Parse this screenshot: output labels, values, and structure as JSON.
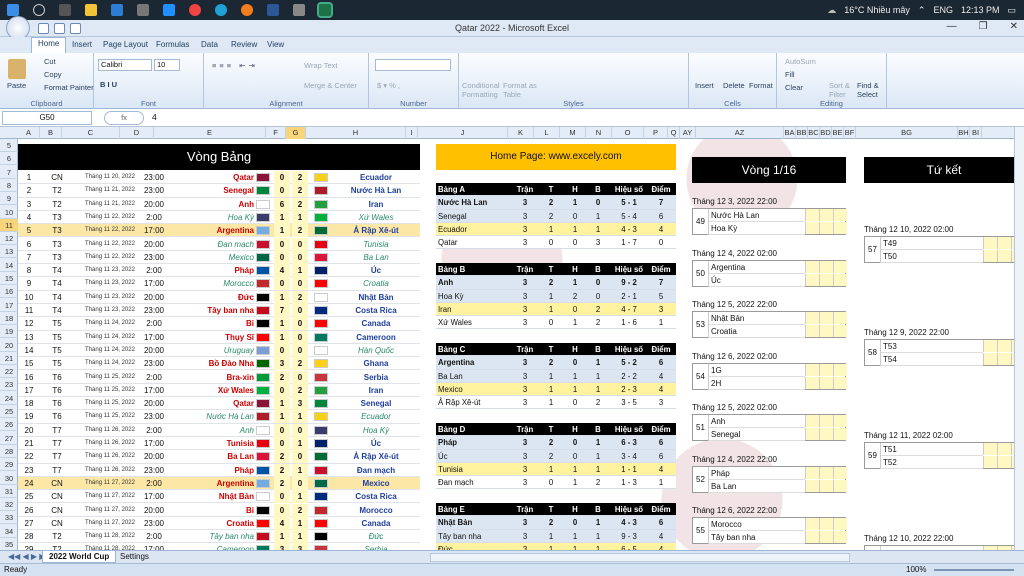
{
  "taskbar": {
    "weather": "16°C  Nhiều mây",
    "lang": "ENG",
    "time": "12:13 PM"
  },
  "window": {
    "title": "Qatar 2022 - Microsoft Excel"
  },
  "ribbon_tabs": [
    "Home",
    "Insert",
    "Page Layout",
    "Formulas",
    "Data",
    "Review",
    "View"
  ],
  "ribbon": {
    "paste": "Paste",
    "cut": "Cut",
    "copy": "Copy",
    "format_painter": "Format Painter",
    "clipboard": "Clipboard",
    "font_name": "Calibri",
    "font_size": "10",
    "font": "Font",
    "wrap": "Wrap Text",
    "merge": "Merge & Center",
    "alignment": "Alignment",
    "number": "Number",
    "cond_fmt": "Conditional Formatting",
    "fmt_table": "Format as Table",
    "styles": "Styles",
    "insert": "Insert",
    "delete": "Delete",
    "format": "Format",
    "cells": "Cells",
    "autosum": "AutoSum",
    "fill": "Fill",
    "clear": "Clear",
    "sort": "Sort & Filter",
    "find": "Find & Select",
    "editing": "Editing"
  },
  "formula_bar": {
    "name_box": "G50",
    "fx": "fx",
    "value": "4"
  },
  "columns": [
    "A",
    "B",
    "C",
    "D",
    "E",
    "F",
    "G",
    "H",
    "I",
    "J",
    "K",
    "L",
    "M",
    "N",
    "O",
    "P",
    "Q",
    "AY",
    "AZ",
    "BA",
    "BB",
    "BC",
    "BD",
    "BE",
    "BF",
    "BG",
    "BH",
    "BI"
  ],
  "rows": [
    "5",
    "6",
    "7",
    "8",
    "9",
    "10",
    "11",
    "12",
    "13",
    "14",
    "15",
    "16",
    "17",
    "18",
    "19",
    "20",
    "21",
    "22",
    "23",
    "24",
    "25",
    "26",
    "27",
    "28",
    "29",
    "30",
    "31",
    "32",
    "33",
    "34",
    "35"
  ],
  "group_stage_title": "Vòng Bảng",
  "matches": [
    {
      "no": "1",
      "grp": "CN",
      "date": "Tháng 11 20, 2022",
      "time": "23:00",
      "home": "Qatar",
      "s1": "0",
      "s2": "2",
      "away": "Ecuador",
      "fa": "#8a1538",
      "fb": "#f7d116"
    },
    {
      "no": "2",
      "grp": "T2",
      "date": "Tháng 11 21, 2022",
      "time": "23:00",
      "home": "Senegal",
      "s1": "0",
      "s2": "2",
      "away": "Nước Hà Lan",
      "fa": "#00853f",
      "fb": "#ae1c28"
    },
    {
      "no": "3",
      "grp": "T2",
      "date": "Tháng 11 21, 2022",
      "time": "20:00",
      "home": "Anh",
      "s1": "6",
      "s2": "2",
      "away": "Iran",
      "fa": "#ffffff",
      "fb": "#239f40"
    },
    {
      "no": "4",
      "grp": "T3",
      "date": "Tháng 11 22, 2022",
      "time": "2:00",
      "home": "Hoa Kỳ",
      "s1": "1",
      "s2": "1",
      "away": "Xứ Wales",
      "fa": "#3c3b6e",
      "fb": "#00b140",
      "it": true
    },
    {
      "no": "5",
      "grp": "T3",
      "date": "Tháng 11 22, 2022",
      "time": "17:00",
      "home": "Argentina",
      "s1": "1",
      "s2": "2",
      "away": "Ả Rập Xê-út",
      "fa": "#74acdf",
      "fb": "#006c35"
    },
    {
      "no": "6",
      "grp": "T3",
      "date": "Tháng 11 22, 2022",
      "time": "20:00",
      "home": "Đan mạch",
      "s1": "0",
      "s2": "0",
      "away": "Tunisia",
      "fa": "#c8102e",
      "fb": "#e70013",
      "it": true
    },
    {
      "no": "7",
      "grp": "T3",
      "date": "Tháng 11 22, 2022",
      "time": "23:00",
      "home": "Mexico",
      "s1": "0",
      "s2": "0",
      "away": "Ba Lan",
      "fa": "#006847",
      "fb": "#dc143c",
      "it": true
    },
    {
      "no": "8",
      "grp": "T4",
      "date": "Tháng 11 23, 2022",
      "time": "2:00",
      "home": "Pháp",
      "s1": "4",
      "s2": "1",
      "away": "Úc",
      "fa": "#0055a4",
      "fb": "#012169"
    },
    {
      "no": "9",
      "grp": "T4",
      "date": "Tháng 11 23, 2022",
      "time": "17:00",
      "home": "Morocco",
      "s1": "0",
      "s2": "0",
      "away": "Croatia",
      "fa": "#c1272d",
      "fb": "#ff0000",
      "it": true
    },
    {
      "no": "10",
      "grp": "T4",
      "date": "Tháng 11 23, 2022",
      "time": "20:00",
      "home": "Đức",
      "s1": "1",
      "s2": "2",
      "away": "Nhật Bản",
      "fa": "#000000",
      "fb": "#ffffff"
    },
    {
      "no": "11",
      "grp": "T4",
      "date": "Tháng 11 23, 2022",
      "time": "23:00",
      "home": "Tây ban nha",
      "s1": "7",
      "s2": "0",
      "away": "Costa Rica",
      "fa": "#c60b1e",
      "fb": "#002b7f"
    },
    {
      "no": "12",
      "grp": "T5",
      "date": "Tháng 11 24, 2022",
      "time": "2:00",
      "home": "Bỉ",
      "s1": "1",
      "s2": "0",
      "away": "Canada",
      "fa": "#000000",
      "fb": "#ff0000"
    },
    {
      "no": "13",
      "grp": "T5",
      "date": "Tháng 11 24, 2022",
      "time": "17:00",
      "home": "Thụy Sĩ",
      "s1": "1",
      "s2": "0",
      "away": "Cameroon",
      "fa": "#ff0000",
      "fb": "#007a5e"
    },
    {
      "no": "14",
      "grp": "T5",
      "date": "Tháng 11 24, 2022",
      "time": "20:00",
      "home": "Uruguay",
      "s1": "0",
      "s2": "0",
      "away": "Hàn Quốc",
      "fa": "#7b9fd4",
      "fb": "#ffffff",
      "it": true
    },
    {
      "no": "15",
      "grp": "T5",
      "date": "Tháng 11 24, 2022",
      "time": "23:00",
      "home": "Bồ Đào Nha",
      "s1": "3",
      "s2": "2",
      "away": "Ghana",
      "fa": "#006600",
      "fb": "#fcd116"
    },
    {
      "no": "16",
      "grp": "T6",
      "date": "Tháng 11 25, 2022",
      "time": "2:00",
      "home": "Bra-xin",
      "s1": "2",
      "s2": "0",
      "away": "Serbia",
      "fa": "#009c3b",
      "fb": "#c6363c"
    },
    {
      "no": "17",
      "grp": "T6",
      "date": "Tháng 11 25, 2022",
      "time": "17:00",
      "home": "Xứ Wales",
      "s1": "0",
      "s2": "2",
      "away": "Iran",
      "fa": "#00b140",
      "fb": "#239f40"
    },
    {
      "no": "18",
      "grp": "T6",
      "date": "Tháng 11 25, 2022",
      "time": "20:00",
      "home": "Qatar",
      "s1": "1",
      "s2": "3",
      "away": "Senegal",
      "fa": "#8a1538",
      "fb": "#00853f"
    },
    {
      "no": "19",
      "grp": "T6",
      "date": "Tháng 11 25, 2022",
      "time": "23:00",
      "home": "Nước Hà Lan",
      "s1": "1",
      "s2": "1",
      "away": "Ecuador",
      "fa": "#ae1c28",
      "fb": "#f7d116",
      "it": true
    },
    {
      "no": "20",
      "grp": "T7",
      "date": "Tháng 11 26, 2022",
      "time": "2:00",
      "home": "Anh",
      "s1": "0",
      "s2": "0",
      "away": "Hoa Kỳ",
      "fa": "#ffffff",
      "fb": "#3c3b6e",
      "it": true
    },
    {
      "no": "21",
      "grp": "T7",
      "date": "Tháng 11 26, 2022",
      "time": "17:00",
      "home": "Tunisia",
      "s1": "0",
      "s2": "1",
      "away": "Úc",
      "fa": "#e70013",
      "fb": "#012169"
    },
    {
      "no": "22",
      "grp": "T7",
      "date": "Tháng 11 26, 2022",
      "time": "20:00",
      "home": "Ba Lan",
      "s1": "2",
      "s2": "0",
      "away": "Ả Rập Xê-út",
      "fa": "#dc143c",
      "fb": "#006c35"
    },
    {
      "no": "23",
      "grp": "T7",
      "date": "Tháng 11 26, 2022",
      "time": "23:00",
      "home": "Pháp",
      "s1": "2",
      "s2": "1",
      "away": "Đan mạch",
      "fa": "#0055a4",
      "fb": "#c8102e"
    },
    {
      "no": "24",
      "grp": "CN",
      "date": "Tháng 11 27, 2022",
      "time": "2:00",
      "home": "Argentina",
      "s1": "2",
      "s2": "0",
      "away": "Mexico",
      "fa": "#74acdf",
      "fb": "#006847"
    },
    {
      "no": "25",
      "grp": "CN",
      "date": "Tháng 11 27, 2022",
      "time": "17:00",
      "home": "Nhật Bản",
      "s1": "0",
      "s2": "1",
      "away": "Costa Rica",
      "fa": "#ffffff",
      "fb": "#002b7f"
    },
    {
      "no": "26",
      "grp": "CN",
      "date": "Tháng 11 27, 2022",
      "time": "20:00",
      "home": "Bỉ",
      "s1": "0",
      "s2": "2",
      "away": "Morocco",
      "fa": "#000000",
      "fb": "#c1272d"
    },
    {
      "no": "27",
      "grp": "CN",
      "date": "Tháng 11 27, 2022",
      "time": "23:00",
      "home": "Croatia",
      "s1": "4",
      "s2": "1",
      "away": "Canada",
      "fa": "#ff0000",
      "fb": "#ff0000"
    },
    {
      "no": "28",
      "grp": "T2",
      "date": "Tháng 11 28, 2022",
      "time": "2:00",
      "home": "Tây ban nha",
      "s1": "1",
      "s2": "1",
      "away": "Đức",
      "fa": "#c60b1e",
      "fb": "#000000",
      "it": true
    },
    {
      "no": "29",
      "grp": "T2",
      "date": "Tháng 11 28, 2022",
      "time": "17:00",
      "home": "Cameroon",
      "s1": "3",
      "s2": "3",
      "away": "Serbia",
      "fa": "#007a5e",
      "fb": "#c6363c",
      "it": true
    }
  ],
  "home_page": "Home Page: www.excely.com",
  "group_headers": [
    "Trận",
    "T",
    "H",
    "B",
    "Hiệu số",
    "Điểm"
  ],
  "groups": [
    {
      "name": "Bảng A",
      "rows": [
        [
          "Nước Hà Lan",
          "3",
          "2",
          "1",
          "0",
          "5 - 1",
          "7"
        ],
        [
          "Senegal",
          "3",
          "2",
          "0",
          "1",
          "5 - 4",
          "6"
        ],
        [
          "Ecuador",
          "3",
          "1",
          "1",
          "1",
          "4 - 3",
          "4"
        ],
        [
          "Qatar",
          "3",
          "0",
          "0",
          "3",
          "1 - 7",
          "0"
        ]
      ]
    },
    {
      "name": "Bảng B",
      "rows": [
        [
          "Anh",
          "3",
          "2",
          "1",
          "0",
          "9 - 2",
          "7"
        ],
        [
          "Hoa Kỳ",
          "3",
          "1",
          "2",
          "0",
          "2 - 1",
          "5"
        ],
        [
          "Iran",
          "3",
          "1",
          "0",
          "2",
          "4 - 7",
          "3"
        ],
        [
          "Xứ Wales",
          "3",
          "0",
          "1",
          "2",
          "1 - 6",
          "1"
        ]
      ]
    },
    {
      "name": "Bảng C",
      "rows": [
        [
          "Argentina",
          "3",
          "2",
          "0",
          "1",
          "5 - 2",
          "6"
        ],
        [
          "Ba Lan",
          "3",
          "1",
          "1",
          "1",
          "2 - 2",
          "4"
        ],
        [
          "Mexico",
          "3",
          "1",
          "1",
          "1",
          "2 - 3",
          "4"
        ],
        [
          "Ả Rập Xê-út",
          "3",
          "1",
          "0",
          "2",
          "3 - 5",
          "3"
        ]
      ]
    },
    {
      "name": "Bảng D",
      "rows": [
        [
          "Pháp",
          "3",
          "2",
          "0",
          "1",
          "6 - 3",
          "6"
        ],
        [
          "Úc",
          "3",
          "2",
          "0",
          "1",
          "3 - 4",
          "6"
        ],
        [
          "Tunisia",
          "3",
          "1",
          "1",
          "1",
          "1 - 1",
          "4"
        ],
        [
          "Đan mạch",
          "3",
          "0",
          "1",
          "2",
          "1 - 3",
          "1"
        ]
      ]
    },
    {
      "name": "Bảng E",
      "rows": [
        [
          "Nhật Bản",
          "3",
          "2",
          "0",
          "1",
          "4 - 3",
          "6"
        ],
        [
          "Tây ban nha",
          "3",
          "1",
          "1",
          "1",
          "9 - 3",
          "4"
        ],
        [
          "Đức",
          "3",
          "1",
          "1",
          "1",
          "6 - 5",
          "4"
        ]
      ]
    }
  ],
  "r16_title": "Vòng 1/16",
  "r16": [
    {
      "date": "Tháng 12 3, 2022   22:00",
      "num": "49",
      "a": "Nước Hà Lan",
      "b": "Hoa Kỳ"
    },
    {
      "date": "Tháng 12 4, 2022   02:00",
      "num": "50",
      "a": "Argentina",
      "b": "Úc"
    },
    {
      "date": "Tháng 12 5, 2022   22:00",
      "num": "53",
      "a": "Nhật Bản",
      "b": "Croatia"
    },
    {
      "date": "Tháng 12 6, 2022   02:00",
      "num": "54",
      "a": "1G",
      "b": "2H"
    },
    {
      "date": "Tháng 12 5, 2022   02:00",
      "num": "51",
      "a": "Anh",
      "b": "Senegal"
    },
    {
      "date": "Tháng 12 4, 2022   22:00",
      "num": "52",
      "a": "Pháp",
      "b": "Ba Lan"
    },
    {
      "date": "Tháng 12 6, 2022   22:00",
      "num": "55",
      "a": "Morocco",
      "b": "Tây ban nha"
    }
  ],
  "qf_title": "Tứ kết",
  "qf": [
    {
      "date": "Tháng 12 10, 2022   02:00",
      "num": "57",
      "a": "T49",
      "b": "T50"
    },
    {
      "date": "Tháng 12 9, 2022   22:00",
      "num": "58",
      "a": "T53",
      "b": "T54"
    },
    {
      "date": "Tháng 12 11, 2022   02:00",
      "num": "59",
      "a": "T51",
      "b": "T52"
    },
    {
      "date": "Tháng 12 10, 2022   22:00",
      "num": "",
      "a": "",
      "b": ""
    }
  ],
  "sheets": [
    "2022 World Cup",
    "Settings"
  ],
  "status": {
    "ready": "Ready",
    "zoom": "100%"
  }
}
